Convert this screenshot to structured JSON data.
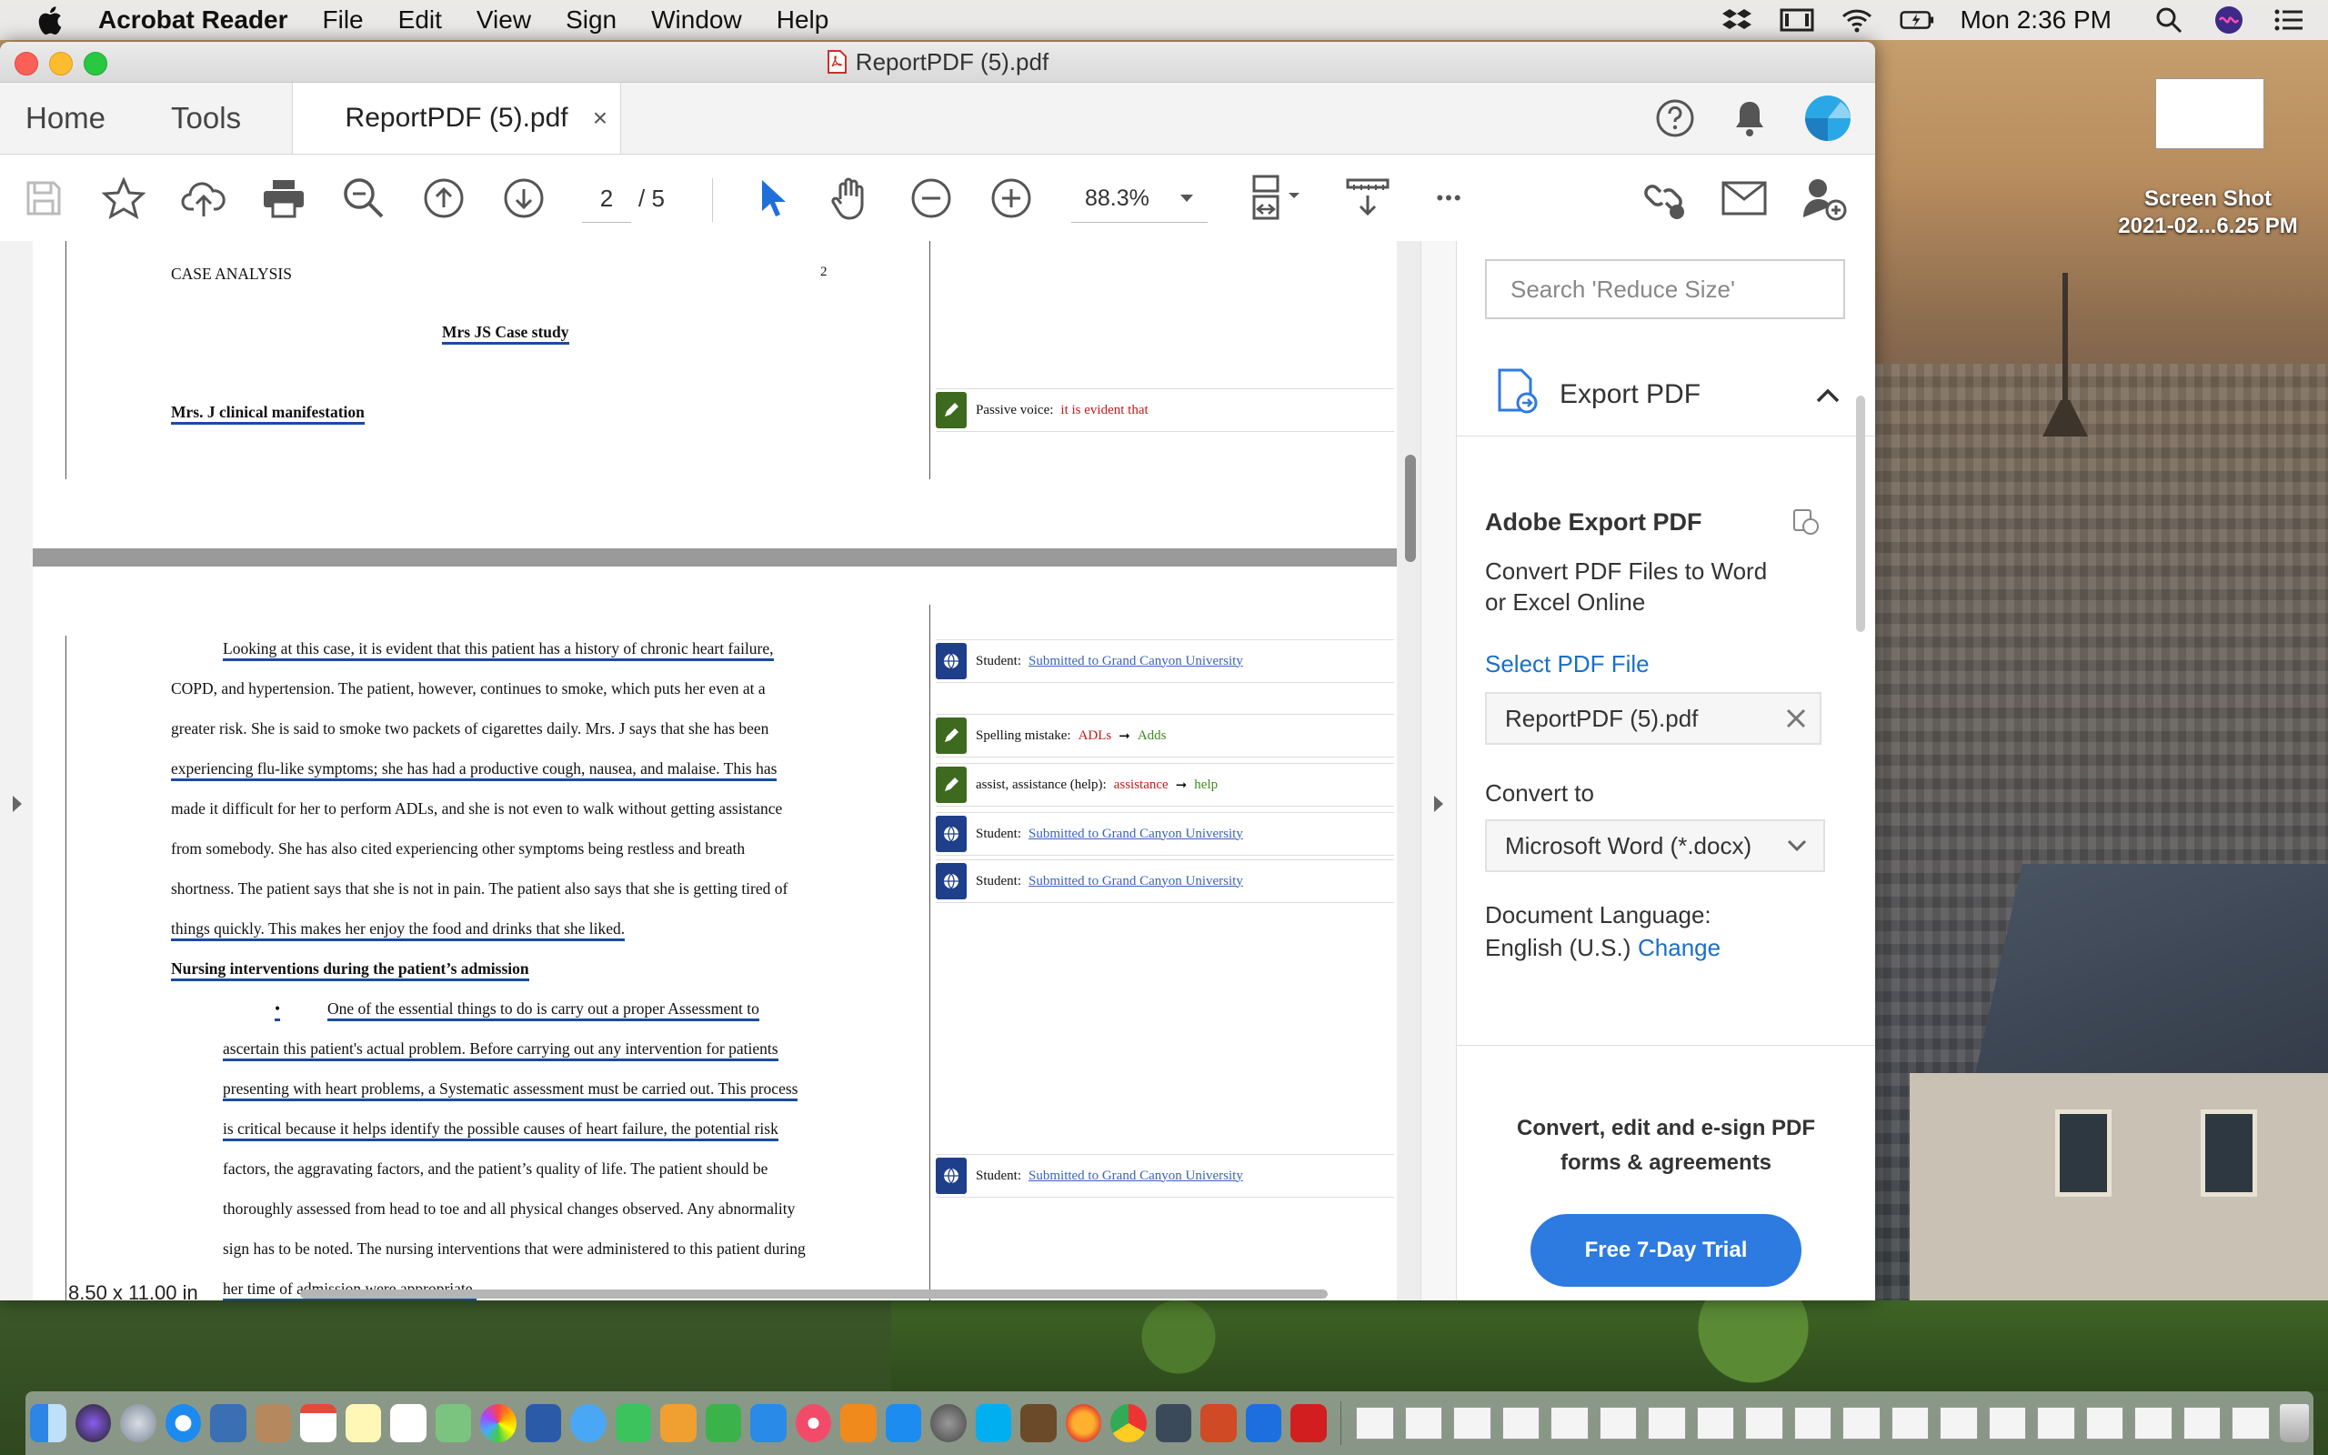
{
  "menubar": {
    "app": "Acrobat Reader",
    "items": [
      "File",
      "Edit",
      "View",
      "Sign",
      "Window",
      "Help"
    ],
    "clock": "Mon 2:36 PM"
  },
  "window": {
    "title": "ReportPDF (5).pdf"
  },
  "tabs": {
    "home": "Home",
    "tools": "Tools",
    "doc": "ReportPDF (5).pdf",
    "close": "×"
  },
  "toolbar": {
    "page_current": "2",
    "page_total": "/ 5",
    "zoom": "88.3%",
    "more": "•••"
  },
  "document": {
    "header_left": "CASE ANALYSIS",
    "header_page": "2",
    "case_title": "Mrs JS Case study",
    "section1": "Mrs. J clinical manifestation",
    "paragraph_lines": [
      "Looking at this case, it is evident that this patient has a history of chronic heart failure,",
      "COPD, and hypertension. The patient, however, continues to smoke, which puts her even at a",
      "greater risk. She is said to smoke two packets of cigarettes daily. Mrs. J says that she has been",
      "experiencing flu-like symptoms; she has had a productive cough, nausea, and malaise. This has",
      "made it difficult for her to perform ADLs, and she is not even to walk without getting assistance",
      "from somebody. She has also cited experiencing other symptoms being restless and breath",
      "shortness. The patient says that she is not in pain. The patient also says that she is getting tired of",
      "things quickly. This makes her enjoy the food and drinks that she liked."
    ],
    "section2": "Nursing interventions during the patient’s admission",
    "bullet": "•",
    "bullet_lines": [
      "One of the essential things to do is carry out a proper Assessment to",
      "ascertain this patient's actual problem. Before carrying out any intervention for patients",
      "presenting with heart problems, a Systematic assessment must be carried out. This process",
      "is critical because it helps identify the possible causes of heart failure, the potential risk",
      "factors, the aggravating factors, and the patient’s quality of life. The patient should be",
      "thoroughly assessed from head to toe and all physical changes observed. Any abnormality",
      "sign has to be noted. The nursing interventions that were administered to this patient during",
      "her time of admission were appropriate."
    ],
    "page_size": "8.50 x 11.00 in"
  },
  "comments": [
    {
      "label": "Passive voice:",
      "value": "it is evident that",
      "kind": "pen"
    },
    {
      "label": "Student:",
      "value": "Submitted to Grand Canyon University",
      "kind": "globe"
    },
    {
      "label": "Spelling mistake:",
      "value": "ADLs",
      "fix": "Adds",
      "kind": "pen"
    },
    {
      "label": "assist, assistance (help):",
      "value": "assistance",
      "fix": "help",
      "kind": "pen"
    },
    {
      "label": "Student:",
      "value": "Submitted to Grand Canyon University",
      "kind": "globe"
    },
    {
      "label": "Student:",
      "value": "Submitted to Grand Canyon University",
      "kind": "globe"
    },
    {
      "label": "Student:",
      "value": "Submitted to Grand Canyon University",
      "kind": "globe"
    }
  ],
  "panel": {
    "search_placeholder": "Search 'Reduce Size'",
    "tool_title": "Export PDF",
    "heading": "Adobe Export PDF",
    "desc1": "Convert PDF Files to Word",
    "desc2": "or Excel Online",
    "select_file": "Select PDF File",
    "file_name": "ReportPDF (5).pdf",
    "convert_to": "Convert to",
    "format": "Microsoft Word (*.docx)",
    "doc_lang": "Document Language:",
    "lang_value": "English (U.S.)",
    "change": "Change",
    "promo1": "Convert, edit and e-sign PDF",
    "promo2": "forms & agreements",
    "trial": "Free 7-Day Trial"
  },
  "desktop": {
    "shot_line1": "Screen Shot",
    "shot_line2": "2021-02...6.25 PM"
  },
  "colors": {
    "accent": "#2d7ae0",
    "link": "#1a6fc9",
    "underline": "#1a4ca0",
    "cursor_blue": "#1e6fd9"
  }
}
